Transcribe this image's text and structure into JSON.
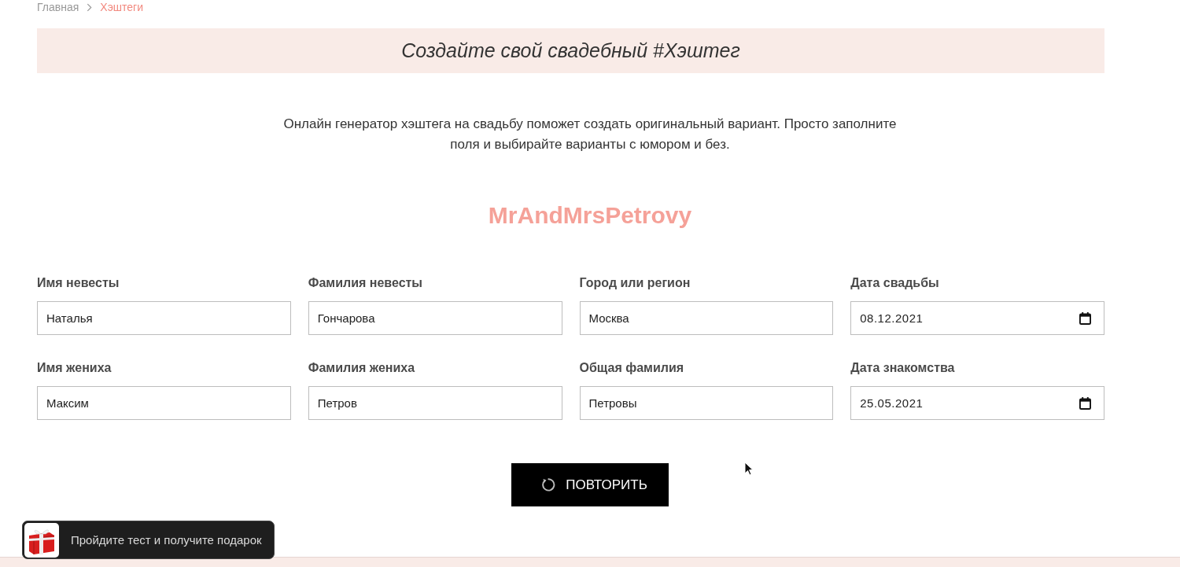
{
  "breadcrumb": [
    {
      "label": "Главная",
      "current": false
    },
    {
      "label": "Хэштеги",
      "current": true
    }
  ],
  "banner": {
    "title": "Создайте свой свадебный #Хэштег"
  },
  "intro": "Онлайн генератор хэштега на свадьбу поможет создать оригинальный вариант. Просто заполните поля и выбирайте варианты с юмором и без.",
  "result": {
    "hashtag": "MrAndMrsPetrovy"
  },
  "fields": [
    {
      "label": "Имя невесты",
      "value": "Наталья",
      "kind": "text"
    },
    {
      "label": "Фамилия невесты",
      "value": "Гончарова",
      "kind": "text"
    },
    {
      "label": "Город или регион",
      "value": "Москва",
      "kind": "text"
    },
    {
      "label": "Дата свадьбы",
      "value": "08.12.2021",
      "kind": "date"
    },
    {
      "label": "Имя жениха",
      "value": "Максим",
      "kind": "text"
    },
    {
      "label": "Фамилия жениха",
      "value": "Петров",
      "kind": "text"
    },
    {
      "label": "Общая фамилия",
      "value": "Петровы",
      "kind": "text"
    },
    {
      "label": "Дата знакомства",
      "value": "25.05.2021",
      "kind": "date"
    }
  ],
  "button": {
    "label": "ПОВТОРИТЬ"
  },
  "promo": {
    "text": "Пройдите тест и получите подарок"
  }
}
